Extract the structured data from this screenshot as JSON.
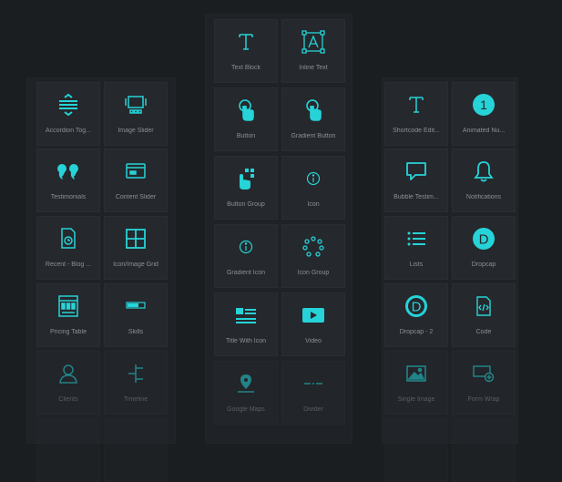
{
  "accent": "#26d3d8",
  "left_panel": {
    "widgets": [
      {
        "label": "Accordion Tog...",
        "icon": "accordion-icon"
      },
      {
        "label": "Image Slider",
        "icon": "image-slider-icon"
      },
      {
        "label": "Testimonials",
        "icon": "quote-icon"
      },
      {
        "label": "Content Slider",
        "icon": "content-slider-icon"
      },
      {
        "label": "Recent - Blog ...",
        "icon": "blog-post-icon"
      },
      {
        "label": "Icon/Image Grid",
        "icon": "grid-icon"
      },
      {
        "label": "Pricing Table",
        "icon": "pricing-table-icon"
      },
      {
        "label": "Skills",
        "icon": "skills-icon"
      },
      {
        "label": "Clients",
        "icon": "clients-icon"
      },
      {
        "label": "Timeline",
        "icon": "timeline-icon"
      }
    ]
  },
  "middle_panel": {
    "widgets": [
      {
        "label": "Text Block",
        "icon": "text-icon"
      },
      {
        "label": "Inline Text",
        "icon": "inline-text-icon"
      },
      {
        "label": "Button",
        "icon": "pointer-icon"
      },
      {
        "label": "Gradient Button",
        "icon": "pointer-icon"
      },
      {
        "label": "Button Group",
        "icon": "button-group-icon"
      },
      {
        "label": "Icon",
        "icon": "info-icon"
      },
      {
        "label": "Gradient Icon",
        "icon": "info-icon"
      },
      {
        "label": "Icon Group",
        "icon": "icon-group-icon"
      },
      {
        "label": "Title With Icon",
        "icon": "title-with-icon-icon"
      },
      {
        "label": "Video",
        "icon": "video-play-icon"
      },
      {
        "label": "Google Maps",
        "icon": "map-pin-icon"
      },
      {
        "label": "Divider",
        "icon": "divider-icon"
      }
    ]
  },
  "right_panel": {
    "widgets": [
      {
        "label": "Shortcode Edit...",
        "icon": "text-icon"
      },
      {
        "label": "Animated Nu...",
        "icon": "animated-number-icon",
        "glyph": "1"
      },
      {
        "label": "Bubble Testim...",
        "icon": "chat-bubble-icon"
      },
      {
        "label": "Notifications",
        "icon": "bell-icon"
      },
      {
        "label": "Lists",
        "icon": "list-icon"
      },
      {
        "label": "Dropcap",
        "icon": "dropcap-icon",
        "glyph": "D"
      },
      {
        "label": "Dropcap - 2",
        "icon": "dropcap-outline-icon",
        "glyph": "D"
      },
      {
        "label": "Code",
        "icon": "code-file-icon"
      },
      {
        "label": "Single Image",
        "icon": "image-icon"
      },
      {
        "label": "Form Wrap",
        "icon": "form-icon"
      }
    ]
  }
}
